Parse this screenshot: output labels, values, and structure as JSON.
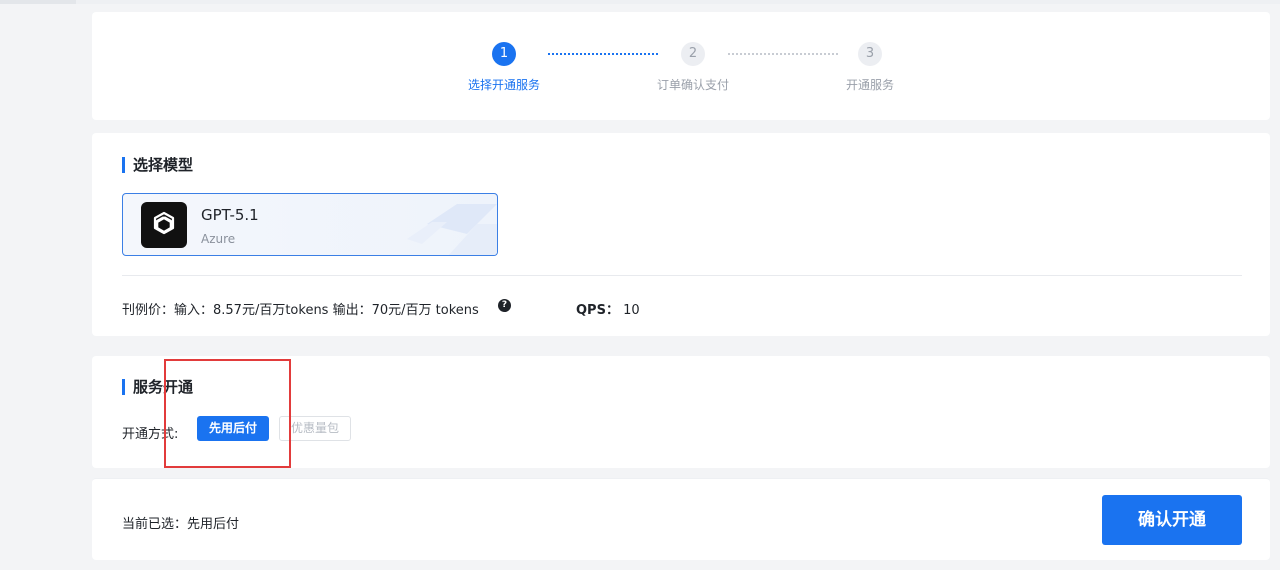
{
  "steps": [
    {
      "number": "1",
      "label": "选择开通服务",
      "state": "active"
    },
    {
      "number": "2",
      "label": "订单确认支付",
      "state": "inactive"
    },
    {
      "number": "3",
      "label": "开通服务",
      "state": "inactive"
    }
  ],
  "model_section": {
    "title": "选择模型",
    "model": {
      "name": "GPT-5.1",
      "provider": "Azure",
      "logo_icon": "openai-logo-icon"
    },
    "price_text": "刊例价：输入：8.57元/百万tokens  输出：70元/百万 tokens",
    "help_icon": "?",
    "qps_label": "QPS：",
    "qps_value": "10"
  },
  "service_section": {
    "title": "服务开通",
    "method_label": "开通方式:",
    "options": [
      {
        "label": "先用后付",
        "selected": true
      },
      {
        "label": "优惠量包",
        "selected": false
      }
    ]
  },
  "footer": {
    "selected_text": "当前已选：先用后付",
    "confirm_label": "确认开通"
  },
  "colors": {
    "accent": "#1a73f0",
    "annotation": "#e23b3b"
  }
}
